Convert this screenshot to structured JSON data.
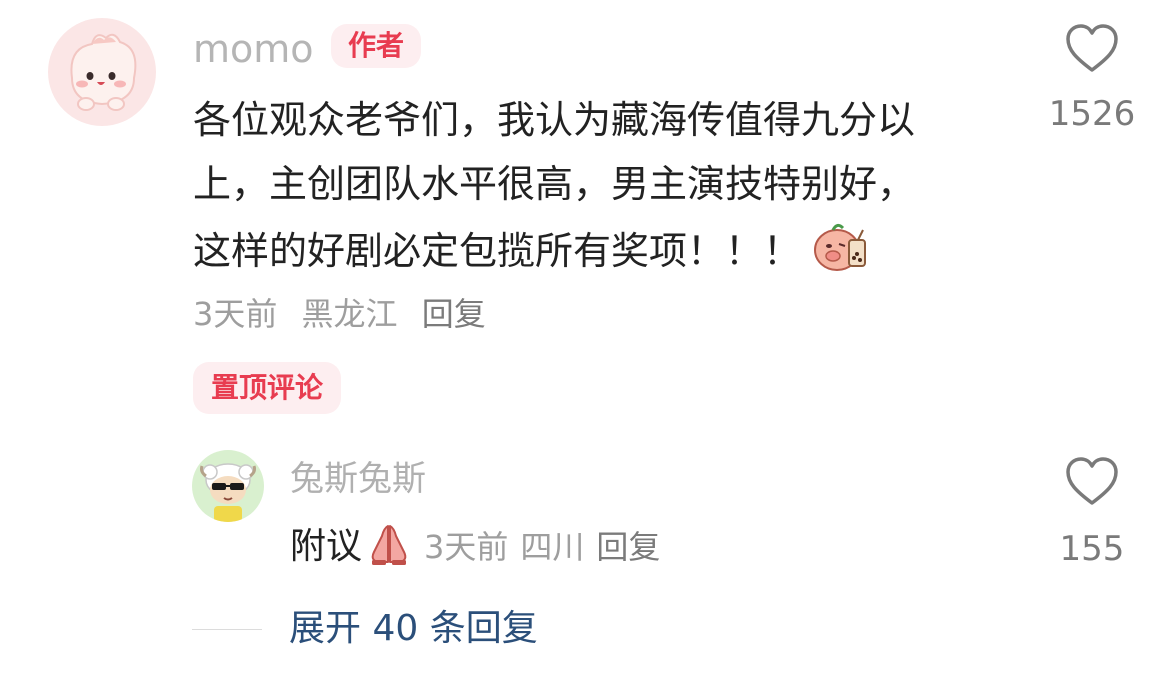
{
  "main_comment": {
    "username": "momo",
    "author_badge": "作者",
    "text_lines": [
      "各位观众老爷们，我认为藏海传值得九分以",
      "上，主创团队水平很高，男主演技特别好，",
      "这样的好剧必定包揽所有奖项！！！"
    ],
    "sticker": "pig-drinking-sticker",
    "time": "3天前",
    "location": "黑龙江",
    "reply_label": "回复",
    "likes": "1526",
    "pinned_label": "置顶评论"
  },
  "reply": {
    "username": "兔斯兔斯",
    "text": "附议",
    "emoji": "praying-hands-icon",
    "time": "3天前",
    "location": "四川",
    "reply_label": "回复",
    "likes": "155"
  },
  "expand": {
    "label": "展开 40 条回复"
  },
  "colors": {
    "accent_red": "#e83c50",
    "badge_bg": "#fdeef0",
    "link_blue": "#2b4f7a",
    "text_main": "#222222",
    "text_muted": "#9e9e9e"
  }
}
